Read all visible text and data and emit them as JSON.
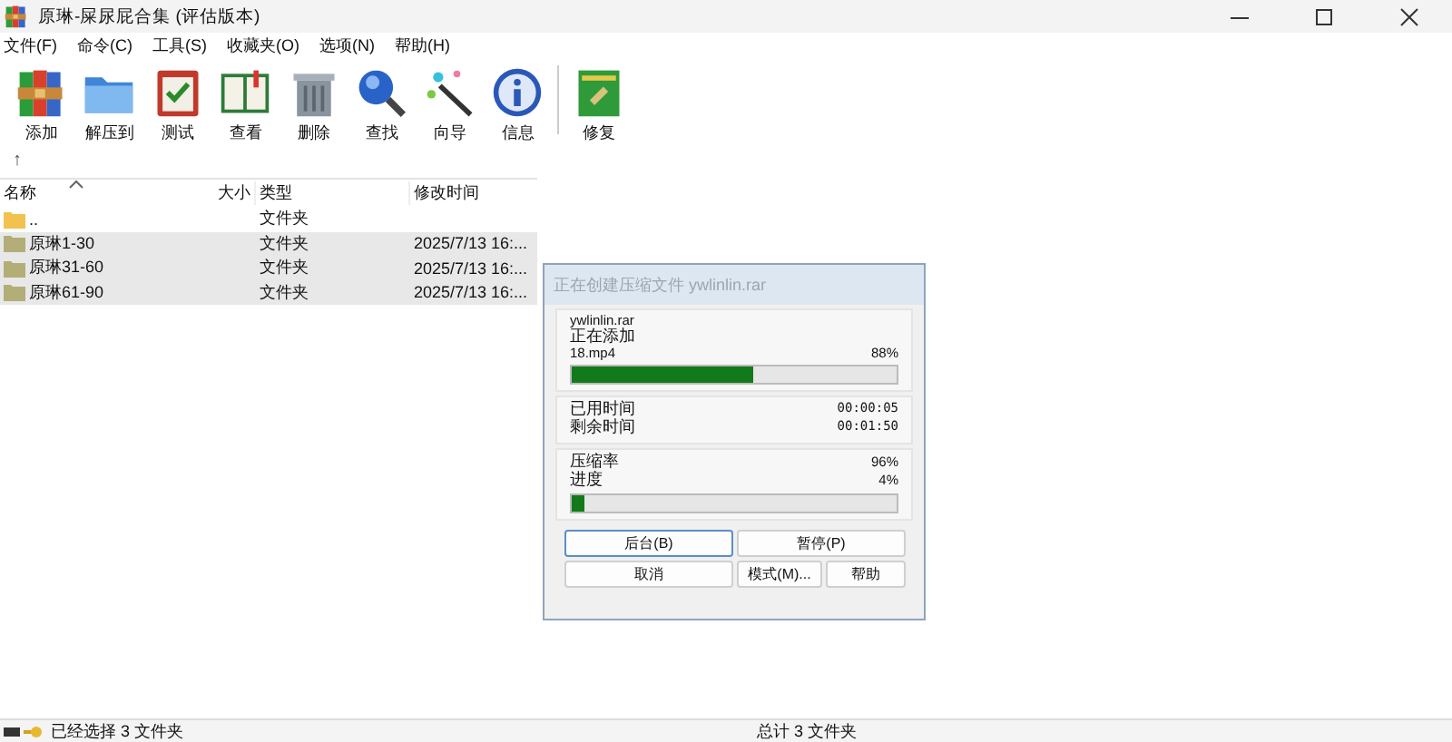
{
  "window": {
    "title": "原琳-屎尿屁合集 (评估版本)"
  },
  "menu": [
    "文件(F)",
    "命令(C)",
    "工具(S)",
    "收藏夹(O)",
    "选项(N)",
    "帮助(H)"
  ],
  "toolbar": [
    {
      "label": "添加",
      "kind": "add"
    },
    {
      "label": "解压到",
      "kind": "extract"
    },
    {
      "label": "测试",
      "kind": "test"
    },
    {
      "label": "查看",
      "kind": "view"
    },
    {
      "label": "删除",
      "kind": "delete"
    },
    {
      "label": "查找",
      "kind": "find"
    },
    {
      "label": "向导",
      "kind": "wizard"
    },
    {
      "label": "信息",
      "kind": "info"
    },
    {
      "label": "修复",
      "kind": "repair"
    }
  ],
  "up_button": "↑",
  "table": {
    "columns": [
      "名称",
      "大小",
      "类型",
      "修改时间"
    ],
    "rows": [
      {
        "kind": "parent",
        "name": "..",
        "size": "",
        "type": "文件夹",
        "modified": "",
        "selected": false
      },
      {
        "kind": "folder",
        "name": "原琳1-30",
        "type": "文件夹",
        "modified": "2025/7/13 16:...",
        "selected": true
      },
      {
        "kind": "folder",
        "name": "原琳31-60",
        "type": "文件夹",
        "modified": "2025/7/13 16:...",
        "selected": true
      },
      {
        "kind": "folder",
        "name": "原琳61-90",
        "type": "文件夹",
        "modified": "2025/7/13 16:...",
        "selected": true
      }
    ]
  },
  "dialog": {
    "title": "正在创建压缩文件 ywlinlin.rar",
    "archive": "ywlinlin.rar",
    "action": "正在添加",
    "file": "18.mp4",
    "file_percent": "88%",
    "file_progress": {
      "level": 0.56
    },
    "times": [
      {
        "label": "已用时间",
        "value": "00:00:05"
      },
      {
        "label": "剩余时间",
        "value": "00:01:50"
      }
    ],
    "ratio_label": "压缩率",
    "ratio": "96%",
    "progress_label": "进度",
    "progress_percent": "4%",
    "progress": {
      "level": 0.04
    },
    "buttons": [
      {
        "label": "后台(B)",
        "default": true
      },
      {
        "label": "暂停(P)",
        "default": false
      },
      {
        "label": "取消",
        "default": false
      },
      {
        "label": "模式(M)...",
        "default": false
      },
      {
        "label": "帮助",
        "default": false
      }
    ]
  },
  "status_bar": {
    "left": "已经选择 3 文件夹",
    "right": "总计 3 文件夹"
  }
}
